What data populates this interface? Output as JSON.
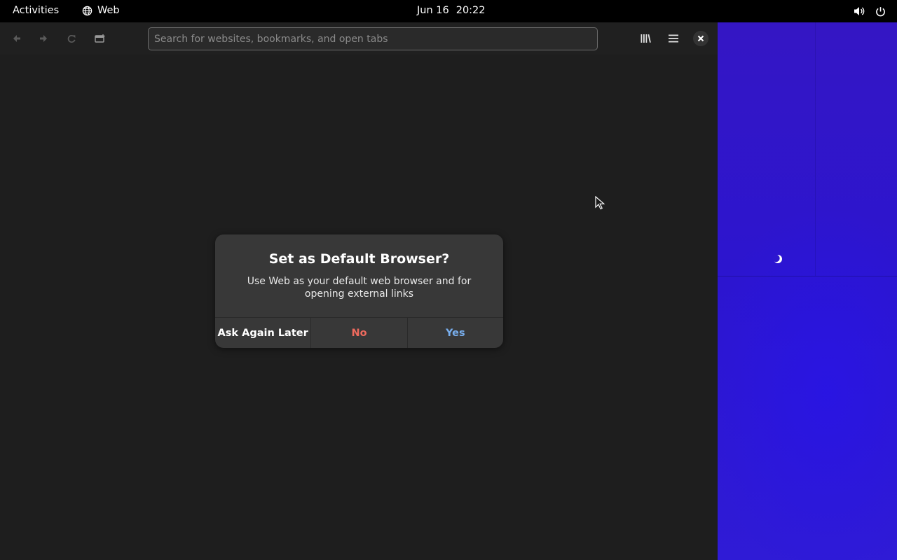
{
  "topbar": {
    "activities": "Activities",
    "app_name": "Web",
    "app_icon": "globe-icon",
    "date": "Jun 16",
    "time": "20:22",
    "tray_icons": [
      "volume-icon",
      "power-icon"
    ]
  },
  "browser": {
    "nav_icons": [
      "back-arrow-icon",
      "forward-arrow-icon",
      "reload-icon",
      "new-tab-icon"
    ],
    "search_placeholder": "Search for websites, bookmarks, and open tabs",
    "right_icons": [
      "library-icon",
      "hamburger-menu-icon",
      "close-icon"
    ]
  },
  "dialog": {
    "title": "Set as Default Browser?",
    "body": "Use Web as your default web browser and for opening external links",
    "buttons": {
      "later": "Ask Again Later",
      "no": "No",
      "yes": "Yes"
    }
  },
  "colors": {
    "topbar_bg": "#000000",
    "window_bg": "#1e1e1e",
    "dialog_bg": "#383838",
    "destructive": "#ee6a5e",
    "accent": "#78aeed",
    "wallpaper": "#2c15cf"
  }
}
